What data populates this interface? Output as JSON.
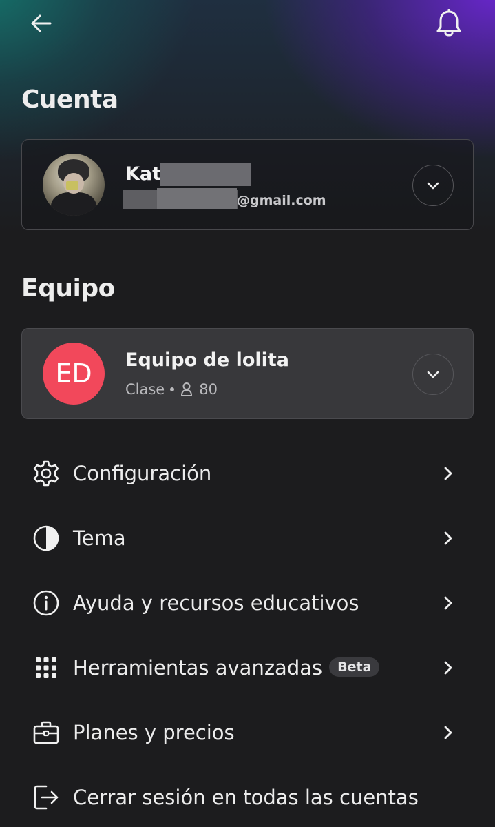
{
  "header": {
    "back_icon": "arrow-left-icon",
    "bell_icon": "bell-icon"
  },
  "account_section": {
    "title": "Cuenta",
    "name_visible": "Kat",
    "email_visible": "@gmail.com",
    "expand_icon": "chevron-down-icon"
  },
  "team_section": {
    "title": "Equipo",
    "team_initials": "ED",
    "team_name": "Equipo de lolita",
    "team_type": "Clase",
    "member_count": "80",
    "member_icon": "person-icon",
    "expand_icon": "chevron-down-icon",
    "avatar_color": "#f2485b"
  },
  "menu": {
    "items": [
      {
        "label": "Configuración",
        "icon": "gear-icon"
      },
      {
        "label": "Tema",
        "icon": "half-circle-icon"
      },
      {
        "label": "Ayuda y recursos educativos",
        "icon": "info-icon"
      },
      {
        "label": "Herramientas avanzadas",
        "icon": "grid-dots-icon",
        "badge": "Beta"
      },
      {
        "label": "Planes y precios",
        "icon": "briefcase-icon"
      },
      {
        "label": "Cerrar sesión en todas las cuentas",
        "icon": "logout-icon"
      }
    ]
  },
  "colors": {
    "background": "#1c1c1e",
    "gradient_teal": "#147870",
    "gradient_purple": "#6c26d2"
  }
}
